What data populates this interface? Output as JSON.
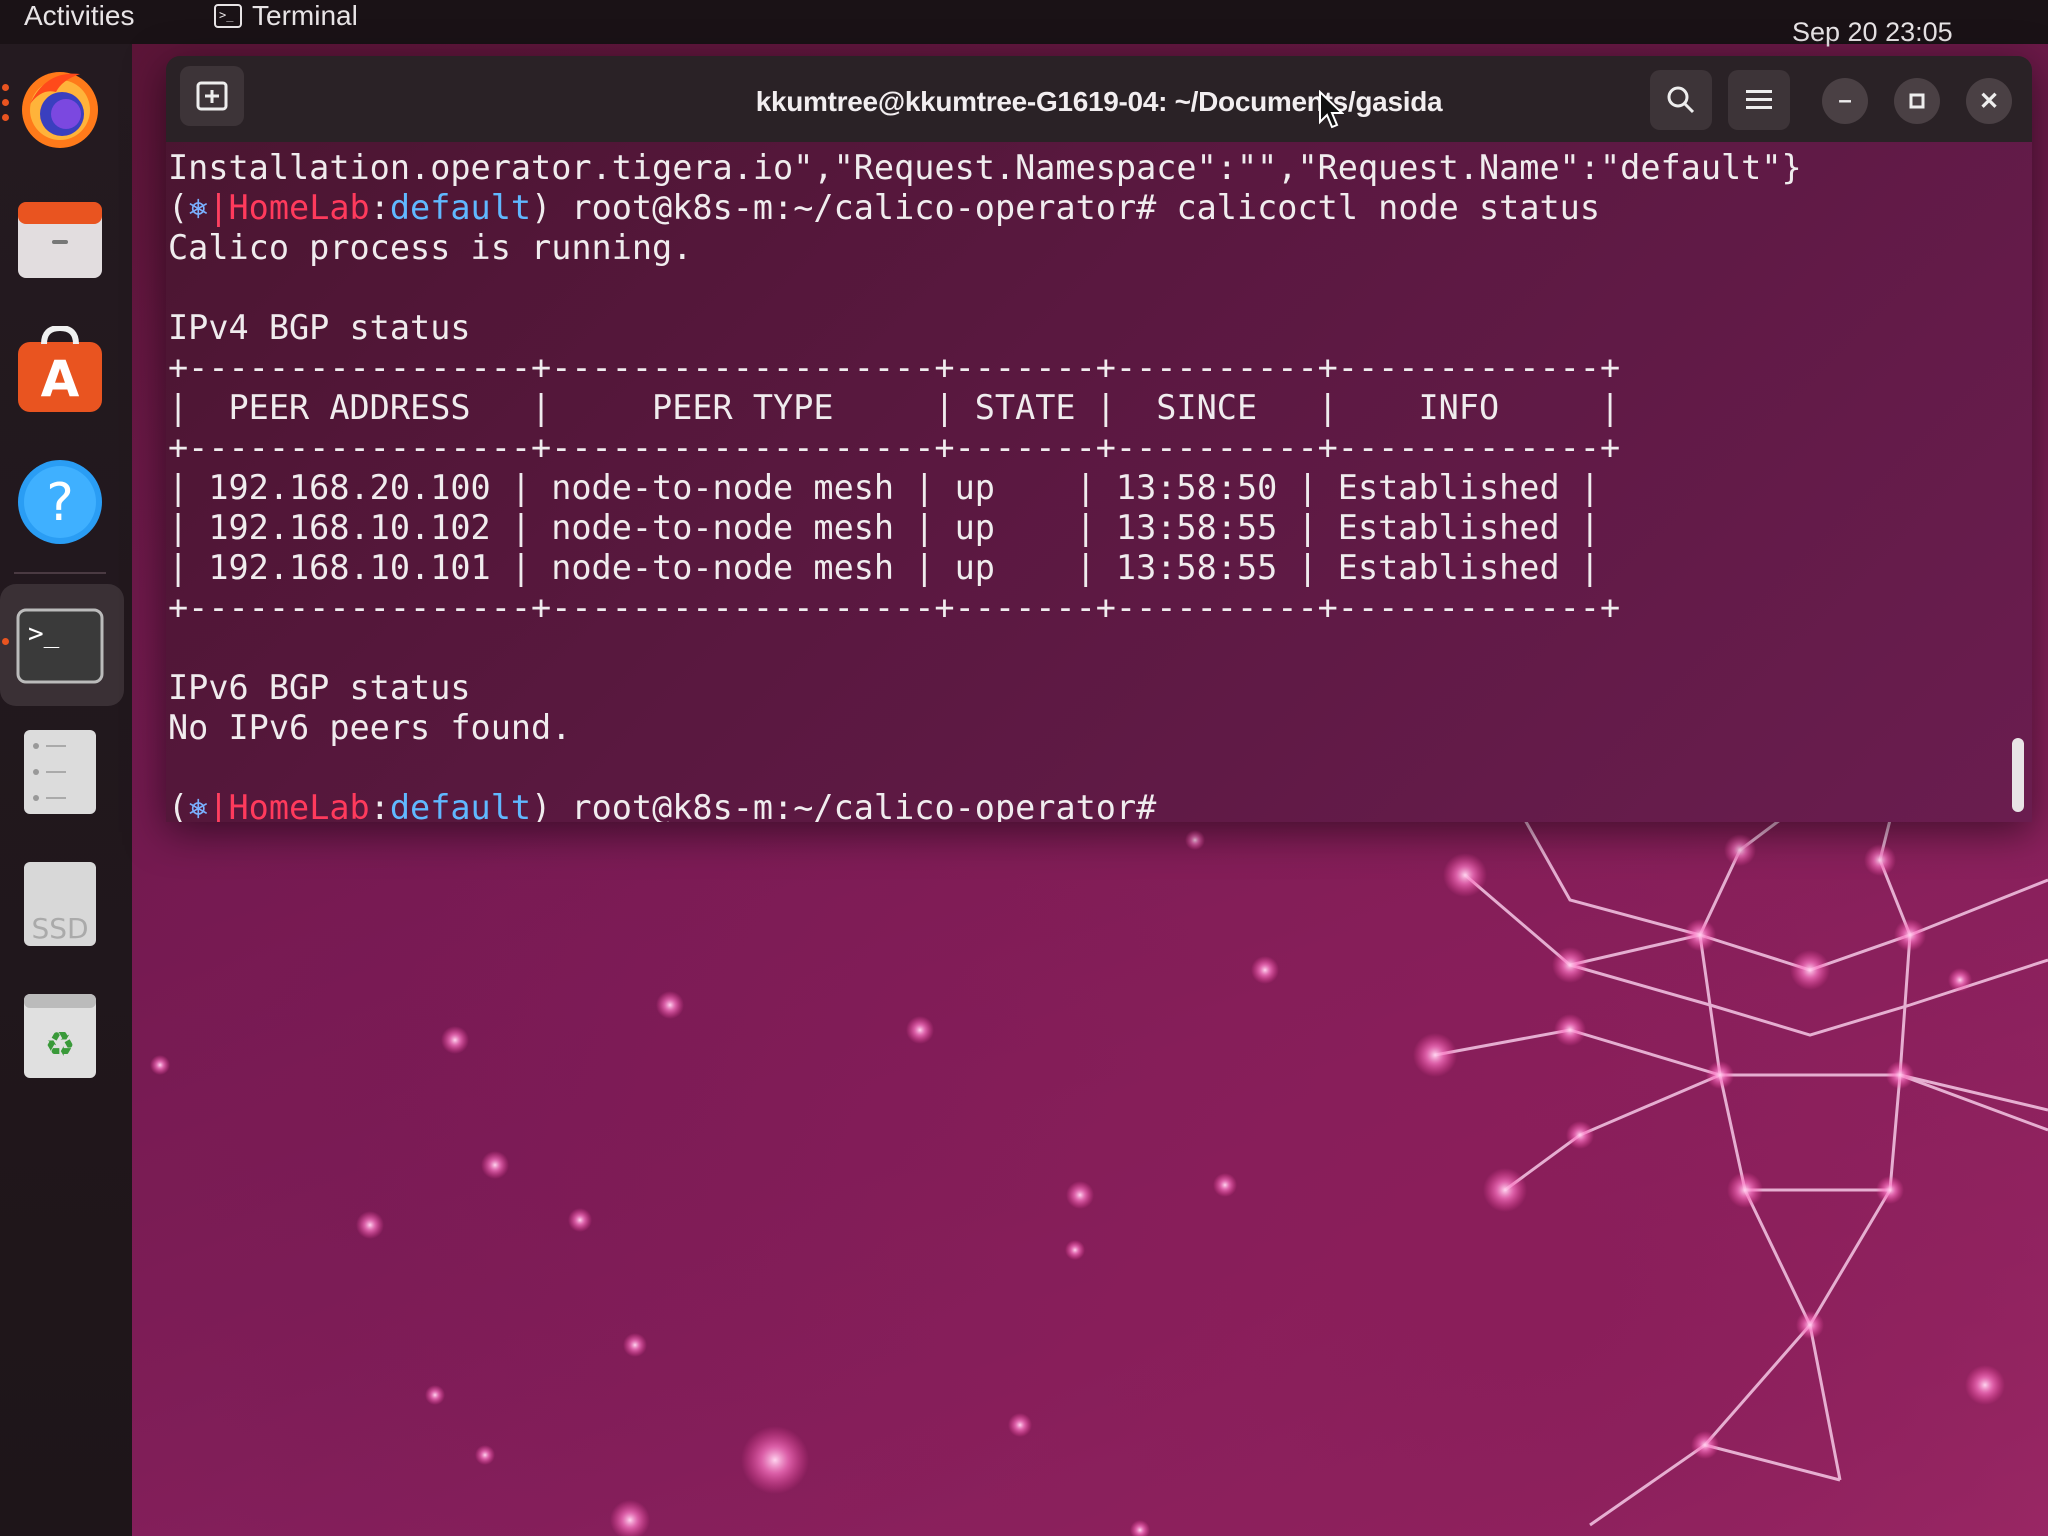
{
  "top_bar": {
    "activities": "Activities",
    "app_name": "Terminal",
    "clock": "Sep 20  23:05"
  },
  "dock": {
    "items": [
      {
        "name": "Firefox",
        "icon": "firefox-icon"
      },
      {
        "name": "Files",
        "icon": "files-icon"
      },
      {
        "name": "Ubuntu Software",
        "icon": "software-icon"
      },
      {
        "name": "Help",
        "icon": "help-icon"
      },
      {
        "name": "Terminal",
        "icon": "terminal-icon",
        "active": true
      },
      {
        "name": "Files Server",
        "icon": "server-icon"
      },
      {
        "name": "SSD",
        "icon": "ssd-icon",
        "label": "SSD"
      },
      {
        "name": "Trash",
        "icon": "trash-icon"
      }
    ]
  },
  "window": {
    "title": "kkumtree@kkumtree-G1619-04: ~/Documents/gasida"
  },
  "terminal": {
    "line_partial": "Installation.operator.tigera.io\",\"Request.Namespace\":\"\",\"Request.Name\":\"default\"}",
    "prompt": {
      "open": "(",
      "star": "⎈",
      "bar": "|",
      "cluster": "HomeLab",
      "colon": ":",
      "namespace": "default",
      "close": ")",
      "user_path": " root@k8s-m:~/calico-operator# "
    },
    "command": "calicoctl node status",
    "running": "Calico process is running.",
    "ipv4_header": "IPv4 BGP status",
    "table_border": "+-----------------+-------------------+-------+----------+-------------+",
    "table_header": "|  PEER ADDRESS   |     PEER TYPE     | STATE |  SINCE   |    INFO     |",
    "table_rows": [
      "| 192.168.20.100 | node-to-node mesh | up    | 13:58:50 | Established |",
      "| 192.168.10.102 | node-to-node mesh | up    | 13:58:55 | Established |",
      "| 192.168.10.101 | node-to-node mesh | up    | 13:58:55 | Established |"
    ],
    "ipv6_header": "IPv6 BGP status",
    "ipv6_none": "No IPv6 peers found."
  },
  "colors": {
    "ubuntu_orange": "#e95420",
    "prompt_cluster": "#ff3a5c",
    "prompt_namespace": "#60b8ff"
  }
}
